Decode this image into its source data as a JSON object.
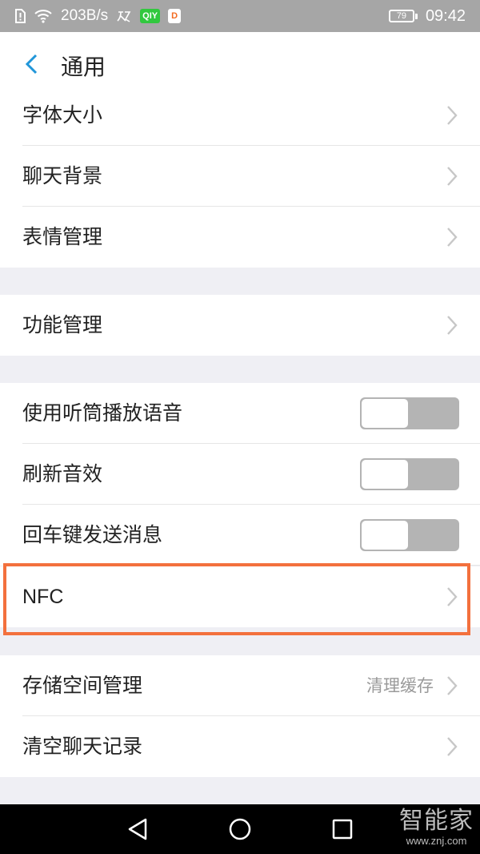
{
  "status_bar": {
    "net_speed": "203B/s",
    "iqiyi_label": "QIY",
    "didi_label": "D",
    "battery": "79",
    "time": "09:42"
  },
  "header": {
    "title": "通用"
  },
  "rows": {
    "font_size": "字体大小",
    "chat_bg": "聊天背景",
    "emoji_mgmt": "表情管理",
    "feature_mgmt": "功能管理",
    "earpiece": "使用听筒播放语音",
    "refresh_sound": "刷新音效",
    "enter_send": "回车键发送消息",
    "nfc": "NFC",
    "storage": "存储空间管理",
    "storage_sub": "清理缓存",
    "clear_history": "清空聊天记录"
  },
  "toggles": {
    "earpiece": false,
    "refresh_sound": false,
    "enter_send": false
  },
  "highlight_color": "#f3703d",
  "watermark": {
    "main": "智能家",
    "sub": "www.znj.com"
  }
}
